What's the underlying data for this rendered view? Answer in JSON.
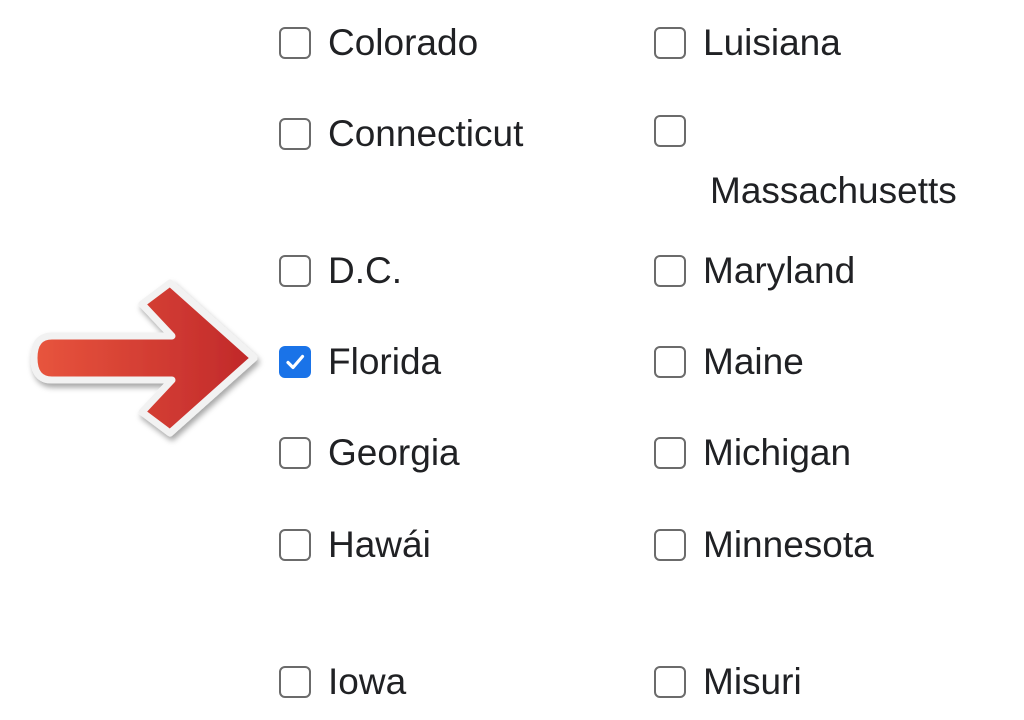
{
  "colors": {
    "checkbox_border": "#6b6b6b",
    "checkbox_checked_fill": "#1a73e8",
    "text": "#202124",
    "arrow_red": "#c9302c",
    "arrow_red_light": "#e8553d"
  },
  "pointer": {
    "icon": "arrow-right-icon"
  },
  "left_column": [
    {
      "label": "Colorado",
      "checked": false
    },
    {
      "label": "Connecticut",
      "checked": false
    },
    {
      "label": "D.C.",
      "checked": false
    },
    {
      "label": "Florida",
      "checked": true
    },
    {
      "label": "Georgia",
      "checked": false
    },
    {
      "label": "Hawái",
      "checked": false
    },
    {
      "label": "Iowa",
      "checked": false
    }
  ],
  "right_column": [
    {
      "label": "Luisiana",
      "checked": false
    },
    {
      "label": "Massachusetts",
      "checked": false
    },
    {
      "label": "Maryland",
      "checked": false
    },
    {
      "label": "Maine",
      "checked": false
    },
    {
      "label": "Michigan",
      "checked": false
    },
    {
      "label": "Minnesota",
      "checked": false
    },
    {
      "label": "Misuri",
      "checked": false
    }
  ]
}
